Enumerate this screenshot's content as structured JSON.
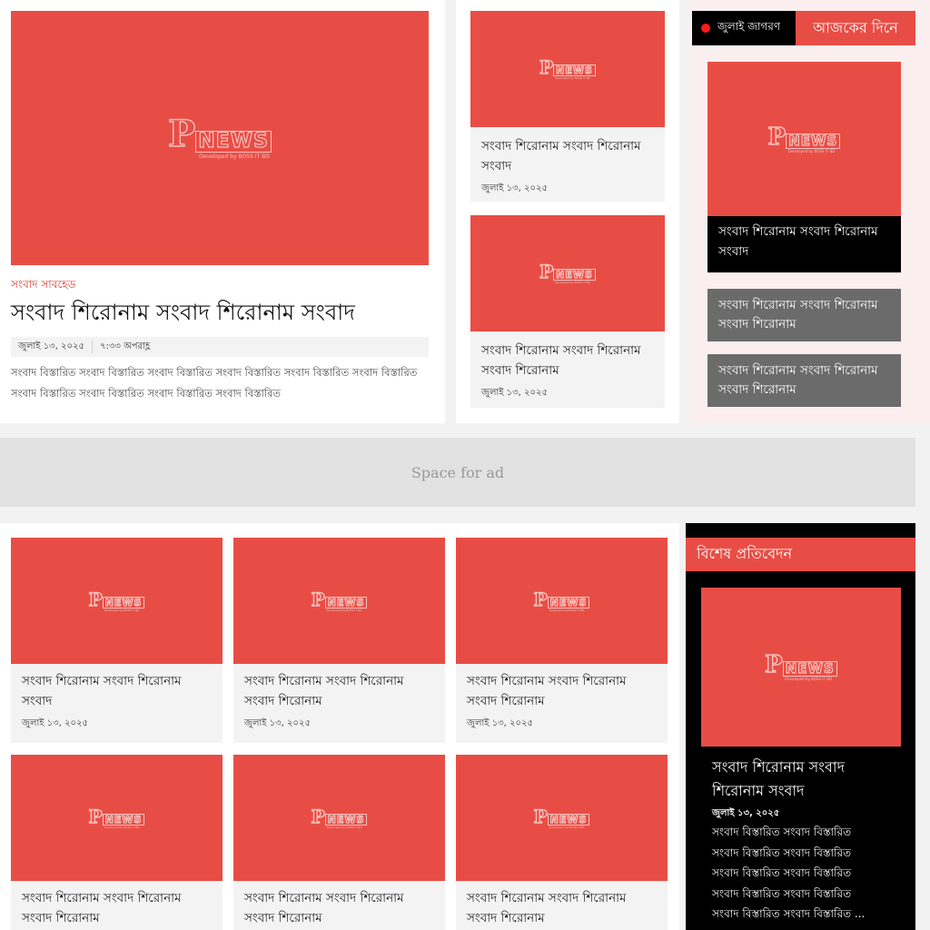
{
  "brand": {
    "logo_letter": "P",
    "logo_word": "NEWS",
    "logo_tagline": "Developed by BOSS IT BD"
  },
  "lead": {
    "kicker": "সংবাদ সাবহেড",
    "title": "সংবাদ শিরোনাম সংবাদ শিরোনাম সংবাদ",
    "date": "জুলাই ১৩, ২০২৫",
    "time": "৭:৩৩ অপরাহ্ণ",
    "summary": "সংবাদ বিস্তারিত সংবাদ বিস্তারিত সংবাদ বিস্তারিত সংবাদ বিস্তারিত সংবাদ বিস্তারিত সংবাদ বিস্তারিত সংবাদ বিস্তারিত সংবাদ বিস্তারিত সংবাদ বিস্তারিত সংবাদ বিস্তারিত"
  },
  "side_cards": [
    {
      "title": "সংবাদ শিরোনাম সংবাদ শিরোনাম সংবাদ",
      "date": "জুলাই ১৩, ২০২৫"
    },
    {
      "title": "সংবাদ শিরোনাম সংবাদ শিরোনাম সংবাদ শিরোনাম",
      "date": "জুলাই ১৩, ২০২৫"
    }
  ],
  "tabs": {
    "live_label": "জুলাই জাগরণ",
    "today_label": "আজকের দিনে"
  },
  "today": {
    "feature_title": "সংবাদ শিরোনাম সংবাদ শিরোনাম সংবাদ",
    "items": [
      "সংবাদ শিরোনাম সংবাদ শিরোনাম সংবাদ শিরোনাম",
      "সংবাদ শিরোনাম সংবাদ শিরোনাম সংবাদ শিরোনাম"
    ]
  },
  "ad": {
    "label": "Space for ad"
  },
  "grid_cards": [
    {
      "title": "সংবাদ শিরোনাম সংবাদ শিরোনাম সংবাদ",
      "date": "জুলাই ১৩, ২০২৫"
    },
    {
      "title": "সংবাদ শিরোনাম সংবাদ শিরোনাম সংবাদ শিরোনাম",
      "date": "জুলাই ১৩, ২০২৫"
    },
    {
      "title": "সংবাদ শিরোনাম সংবাদ শিরোনাম সংবাদ শিরোনাম",
      "date": "জুলাই ১৩, ২০২৫"
    },
    {
      "title": "সংবাদ শিরোনাম সংবাদ শিরোনাম সংবাদ শিরোনাম",
      "date": ""
    },
    {
      "title": "সংবাদ শিরোনাম সংবাদ শিরোনাম সংবাদ শিরোনাম",
      "date": ""
    },
    {
      "title": "সংবাদ শিরোনাম সংবাদ শিরোনাম সংবাদ শিরোনাম",
      "date": ""
    }
  ],
  "special": {
    "heading": "বিশেষ প্রতিবেদন",
    "title": "সংবাদ শিরোনাম সংবাদ শিরোনাম সংবাদ",
    "date": "জুলাই ১৩, ২০২৫",
    "lines": [
      "সংবাদ বিস্তারিত সংবাদ বিস্তারিত",
      "সংবাদ বিস্তারিত সংবাদ বিস্তারিত",
      "সংবাদ বিস্তারিত সংবাদ বিস্তারিত",
      "সংবাদ বিস্তারিত সংবাদ বিস্তারিত",
      "সংবাদ বিস্তারিত সংবাদ বিস্তারিত ..."
    ]
  },
  "colors": {
    "accent": "#e84d45",
    "dark": "#000000",
    "grey_item": "#6b6b6b",
    "live_dot": "#ff1a1a"
  }
}
